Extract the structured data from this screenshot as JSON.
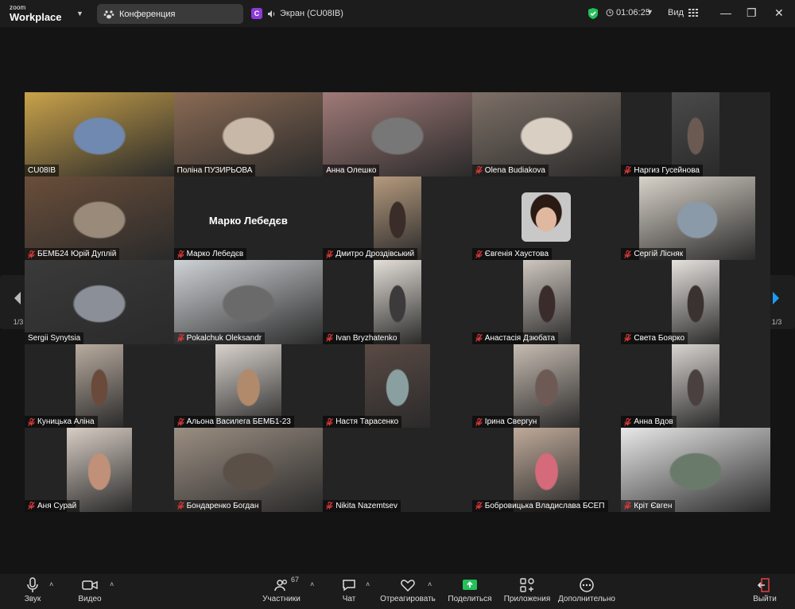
{
  "app": {
    "logo_small": "zoom",
    "logo_big": "Workplace"
  },
  "titlebar": {
    "conference_label": "Конференция",
    "screen_badge": "C",
    "screen_label": "Экран (CU08IB)",
    "timer": "01:06:25",
    "view_label": "Вид"
  },
  "participants": [
    {
      "name": "CU08IB",
      "muted": false
    },
    {
      "name": "Поліна ПУЗИРЬОВА",
      "muted": false
    },
    {
      "name": "Анна Олешко",
      "muted": false,
      "speaking": true
    },
    {
      "name": "Olena Budiakova",
      "muted": true
    },
    {
      "name": "Наргиз Гусейнова",
      "muted": true
    },
    {
      "name": "БЕМБ24 Юрій Дуплій",
      "muted": true
    },
    {
      "name": "Марко Лебедєв",
      "muted": true,
      "video_off": true,
      "display_name": "Марко Лебедєв"
    },
    {
      "name": "Дмитро Дроздівський",
      "muted": true
    },
    {
      "name": "Євгенія Хаустова",
      "muted": true,
      "video_off": true
    },
    {
      "name": "Сергій Лісняк",
      "muted": true
    },
    {
      "name": "Sergii Synytsia",
      "muted": false
    },
    {
      "name": "Pokalchuk Oleksandr",
      "muted": true
    },
    {
      "name": "Ivan Bryzhatenko",
      "muted": true
    },
    {
      "name": "Анастасія Дзюбата",
      "muted": true
    },
    {
      "name": "Света Боярко",
      "muted": true
    },
    {
      "name": "Куницька Аліна",
      "muted": true
    },
    {
      "name": "Альона Василега БЕМБ1-23",
      "muted": true
    },
    {
      "name": "Настя Тарасенко",
      "muted": true
    },
    {
      "name": "Ірина Свергун",
      "muted": true
    },
    {
      "name": "Анна Вдов",
      "muted": true
    },
    {
      "name": "Аня Сурай",
      "muted": true
    },
    {
      "name": "Бондаренко Богдан",
      "muted": true
    },
    {
      "name": "Nikita Nazemtsev",
      "muted": true,
      "video_off": true
    },
    {
      "name": "Бобровицька Владислава БСЕП",
      "muted": true
    },
    {
      "name": "Кріт Євген",
      "muted": true
    }
  ],
  "pager": {
    "left_label": "1/3",
    "right_label": "1/3"
  },
  "toolbar": {
    "audio": "Звук",
    "video": "Видео",
    "participants": "Участники",
    "participants_count": "67",
    "chat": "Чат",
    "react": "Отреагировать",
    "share": "Поделиться",
    "apps": "Приложения",
    "more": "Дополнительно",
    "leave": "Выйти"
  },
  "colors": {
    "accent_green": "#3ad66f",
    "share_green": "#23c05b",
    "mute_red": "#e03c3c",
    "pager_blue": "#1e9bf0"
  }
}
